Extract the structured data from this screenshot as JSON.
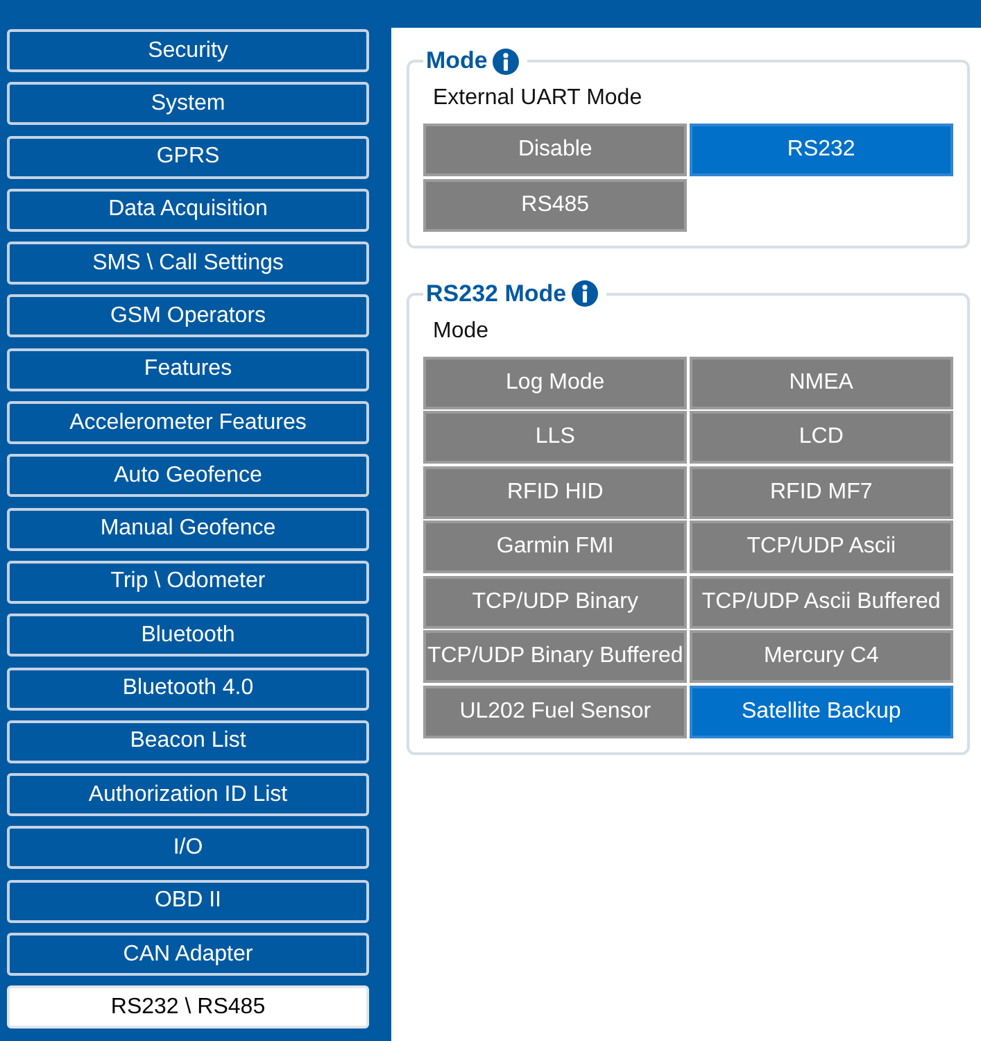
{
  "sidebar": {
    "items": [
      {
        "label": "Security",
        "selected": false
      },
      {
        "label": "System",
        "selected": false
      },
      {
        "label": "GPRS",
        "selected": false
      },
      {
        "label": "Data Acquisition",
        "selected": false
      },
      {
        "label": "SMS \\ Call Settings",
        "selected": false
      },
      {
        "label": "GSM Operators",
        "selected": false
      },
      {
        "label": "Features",
        "selected": false
      },
      {
        "label": "Accelerometer Features",
        "selected": false
      },
      {
        "label": "Auto Geofence",
        "selected": false
      },
      {
        "label": "Manual Geofence",
        "selected": false
      },
      {
        "label": "Trip \\ Odometer",
        "selected": false
      },
      {
        "label": "Bluetooth",
        "selected": false
      },
      {
        "label": "Bluetooth 4.0",
        "selected": false
      },
      {
        "label": "Beacon List",
        "selected": false
      },
      {
        "label": "Authorization ID List",
        "selected": false
      },
      {
        "label": "I/O",
        "selected": false
      },
      {
        "label": "OBD II",
        "selected": false
      },
      {
        "label": "CAN Adapter",
        "selected": false
      },
      {
        "label": "RS232 \\ RS485",
        "selected": true
      }
    ]
  },
  "sections": [
    {
      "title": "Mode",
      "label": "External UART Mode",
      "options": [
        {
          "label": "Disable",
          "selected": false
        },
        {
          "label": "RS232",
          "selected": true
        },
        {
          "label": "RS485",
          "selected": false
        }
      ]
    },
    {
      "title": "RS232 Mode",
      "label": "Mode",
      "options": [
        {
          "label": "Log Mode",
          "selected": false
        },
        {
          "label": "NMEA",
          "selected": false
        },
        {
          "label": "LLS",
          "selected": false
        },
        {
          "label": "LCD",
          "selected": false
        },
        {
          "label": "RFID HID",
          "selected": false
        },
        {
          "label": "RFID MF7",
          "selected": false
        },
        {
          "label": "Garmin FMI",
          "selected": false
        },
        {
          "label": "TCP/UDP Ascii",
          "selected": false
        },
        {
          "label": "TCP/UDP Binary",
          "selected": false
        },
        {
          "label": "TCP/UDP Ascii Buffered",
          "selected": false
        },
        {
          "label": "TCP/UDP Binary Buffered",
          "selected": false
        },
        {
          "label": "Mercury C4",
          "selected": false
        },
        {
          "label": "UL202 Fuel Sensor",
          "selected": false
        },
        {
          "label": "Satellite Backup",
          "selected": true
        }
      ]
    }
  ]
}
